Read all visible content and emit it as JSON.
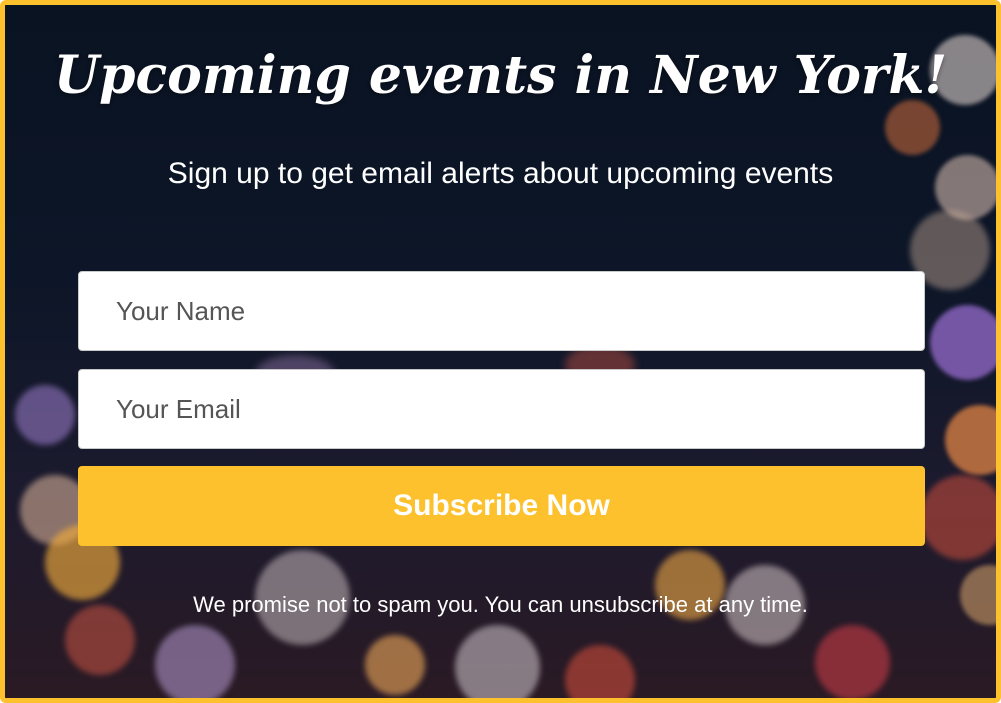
{
  "signup": {
    "title": "Upcoming events in New York!",
    "subtitle": "Sign up to get email alerts about upcoming events",
    "name_placeholder": "Your Name",
    "email_placeholder": "Your Email",
    "subscribe_label": "Subscribe Now",
    "disclaimer": "We promise not to spam you. You can unsubscribe at any time."
  },
  "colors": {
    "accent": "#fcc12d",
    "background": "#0b1426",
    "text": "#ffffff"
  }
}
